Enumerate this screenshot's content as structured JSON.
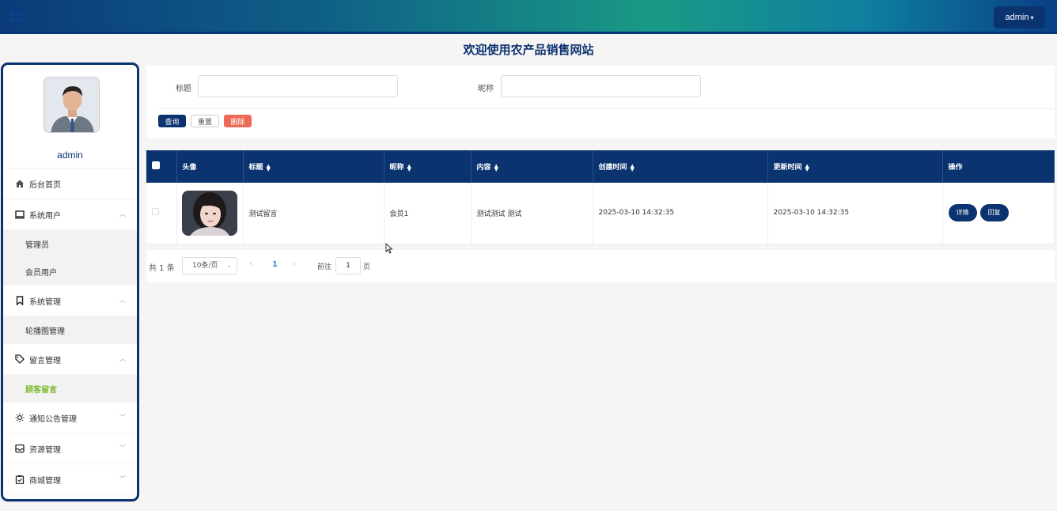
{
  "header": {
    "user_button": "admin"
  },
  "site_title": "欢迎使用农产品销售网站",
  "sidebar": {
    "username": "admin",
    "items": [
      {
        "label": "后台首页",
        "icon": "home-icon"
      },
      {
        "label": "系统用户",
        "icon": "monitor-icon",
        "expanded": true,
        "children": [
          {
            "label": "管理员"
          },
          {
            "label": "会员用户"
          }
        ]
      },
      {
        "label": "系统管理",
        "icon": "bookmark-icon",
        "expanded": true,
        "children": [
          {
            "label": "轮播图管理"
          }
        ]
      },
      {
        "label": "留言管理",
        "icon": "tag-icon",
        "expanded": true,
        "children": [
          {
            "label": "顾客留言",
            "active": true
          }
        ]
      },
      {
        "label": "通知公告管理",
        "icon": "sun-icon"
      },
      {
        "label": "资源管理",
        "icon": "inbox-icon"
      },
      {
        "label": "商城管理",
        "icon": "clipboard-icon"
      }
    ]
  },
  "search": {
    "title_label": "标题",
    "nickname_label": "昵称",
    "query_button": "查询",
    "reset_button": "重置",
    "delete_button": "删除"
  },
  "table": {
    "columns": [
      "头像",
      "标题",
      "昵称",
      "内容",
      "创建时间",
      "更新时间",
      "操作"
    ],
    "rows": [
      {
        "title": "测试留言",
        "nickname": "会员1",
        "content": "测试测试 测试",
        "created": "2025-03-10 14:32:35",
        "updated": "2025-03-10 14:32:35",
        "detail_button": "详情",
        "reply_button": "回复"
      }
    ]
  },
  "pagination": {
    "total": "共 1 条",
    "page_size": "10条/页",
    "current_page": "1",
    "goto_label": "前往",
    "goto_value": "1",
    "goto_unit": "页"
  },
  "colors": {
    "primary": "#0b3370",
    "delete": "#ee6a58",
    "active_menu": "#7cbb2e"
  }
}
